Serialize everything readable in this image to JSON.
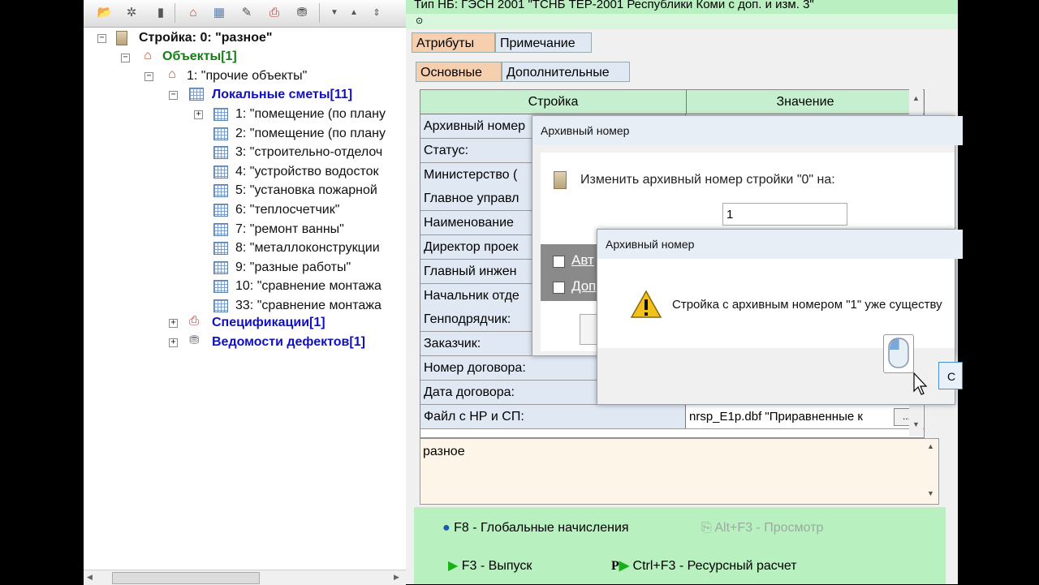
{
  "left_tree": {
    "root": "Стройка: 0: \"разное\"",
    "objects": "Объекты[1]",
    "object1": "1: \"прочие объекты\"",
    "local_estimates": "Локальные сметы[11]",
    "estimates": [
      "1: \"помещение (по плану",
      "2: \"помещение (по плану",
      "3: \"строительно-отделоч",
      "4: \"устройство водосток",
      "5: \"установка пожарной",
      "6: \"теплосчетчик\"",
      "7: \"ремонт ванны\"",
      "8: \"металлоконструкции",
      "9: \"разные работы\"",
      "10: \"сравнение монтажа",
      "33: \"сравнение монтажа"
    ],
    "specifications": "Спецификации[1]",
    "defects": "Ведомости дефектов[1]"
  },
  "header": {
    "title": "Тип НБ: ГЭСН 2001 \"ТСНБ ТЕР-2001 Республики Коми с доп. и изм. 3\""
  },
  "tabs": {
    "attributes": "Атрибуты",
    "note": "Примечание",
    "main": "Основные",
    "additional": "Дополнительные"
  },
  "grid": {
    "col1": "Стройка",
    "col2": "Значение",
    "rows": [
      {
        "label": "Архивный номер",
        "value": ""
      },
      {
        "label": "Статус:",
        "value": ""
      },
      {
        "label": "Министерство (",
        "value": ""
      },
      {
        "label": "Главное управл",
        "value": ""
      },
      {
        "label": "Наименование",
        "value": ""
      },
      {
        "label": "Директор проек",
        "value": ""
      },
      {
        "label": "Главный инжен",
        "value": ""
      },
      {
        "label": "Начальник отде",
        "value": ""
      },
      {
        "label": "Генподрядчик:",
        "value": ""
      },
      {
        "label": "Заказчик:",
        "value": ""
      },
      {
        "label": "Номер договора:",
        "value": ""
      },
      {
        "label": "Дата договора:",
        "value": ""
      },
      {
        "label": "Файл с НР и СП:",
        "value": "nrsp_E1p.dbf \"Приравненные к"
      }
    ],
    "ellipsis_label": "..."
  },
  "note_text": "разное",
  "bottom_buttons": {
    "f8": "F8 - Глобальные начисления",
    "altf3": "Alt+F3 - Просмотр",
    "f3": "F3 - Выпуск",
    "ctrlf3": "Ctrl+F3 - Ресурсный расчет"
  },
  "dialog1": {
    "title": "Архивный номер",
    "prompt": "Изменить архивный номер стройки \"0\" на:",
    "input_value": "1",
    "check1": "Авт",
    "check2": "Доп"
  },
  "dialog2": {
    "title": "Архивный номер",
    "message": "Стройка с архивным номером \"1\" уже существу",
    "button": "С"
  },
  "colors": {
    "green_header": "#b9efc1",
    "tab_active": "#f6cfae",
    "blue_label": "#1010c0",
    "green_label": "#108010"
  }
}
